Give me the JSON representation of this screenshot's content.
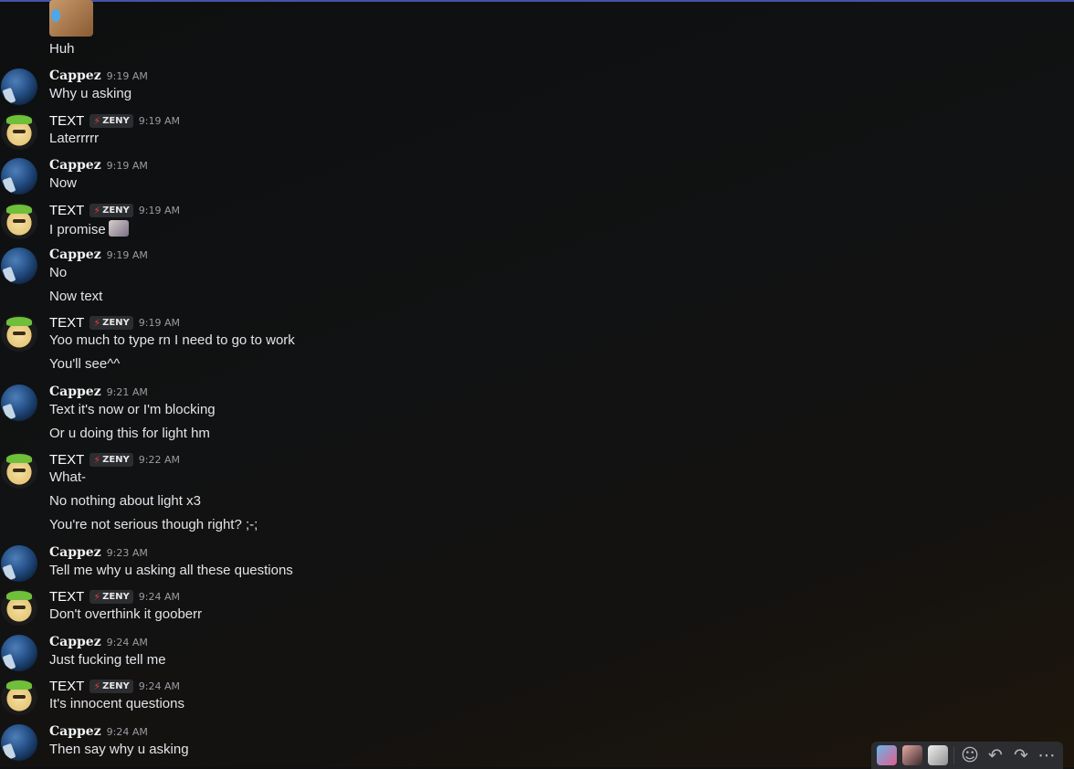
{
  "top_message": {
    "text": "Huh"
  },
  "messages": [
    {
      "author": "Cappez",
      "time": "9:19 AM",
      "lines": [
        "Why u asking"
      ]
    },
    {
      "author": "TEXT",
      "tag": "ZENY",
      "time": "9:19 AM",
      "lines": [
        "Laterrrrr"
      ]
    },
    {
      "author": "Cappez",
      "time": "9:19 AM",
      "lines": [
        "Now"
      ]
    },
    {
      "author": "TEXT",
      "tag": "ZENY",
      "time": "9:19 AM",
      "lines": [
        "I promise"
      ]
    },
    {
      "author": "Cappez",
      "time": "9:19 AM",
      "lines": [
        "No",
        "Now text"
      ]
    },
    {
      "author": "TEXT",
      "tag": "ZENY",
      "time": "9:19 AM",
      "lines": [
        "Yoo much to type rn I need to go to work",
        "You'll see^^"
      ]
    },
    {
      "author": "Cappez",
      "time": "9:21 AM",
      "lines": [
        "Text it's now or I'm blocking",
        "Or u doing this for light hm"
      ]
    },
    {
      "author": "TEXT",
      "tag": "ZENY",
      "time": "9:22 AM",
      "lines": [
        "What-",
        "No nothing about light x3",
        "You're not serious though right? ;-;"
      ]
    },
    {
      "author": "Cappez",
      "time": "9:23 AM",
      "lines": [
        "Tell me why u asking all these questions"
      ]
    },
    {
      "author": "TEXT",
      "tag": "ZENY",
      "time": "9:24 AM",
      "lines": [
        "Don't overthink it gooberr"
      ]
    },
    {
      "author": "Cappez",
      "time": "9:24 AM",
      "lines": [
        "Just fucking tell me"
      ]
    },
    {
      "author": "TEXT",
      "tag": "ZENY",
      "time": "9:24 AM",
      "lines": [
        "It's innocent questions"
      ]
    },
    {
      "author": "Cappez",
      "time": "9:24 AM",
      "lines": [
        "Then say why u asking"
      ]
    }
  ],
  "toolbar": {
    "reactions": [
      "reaction-emoji-1",
      "reaction-emoji-2",
      "reaction-emoji-3"
    ],
    "icons": {
      "add_reaction": "☺",
      "reply": "↶",
      "forward": "↷",
      "more": "⋯"
    }
  },
  "colors": {
    "accent_topline": "#4552a8",
    "tag_bolt": "#e0403a"
  }
}
